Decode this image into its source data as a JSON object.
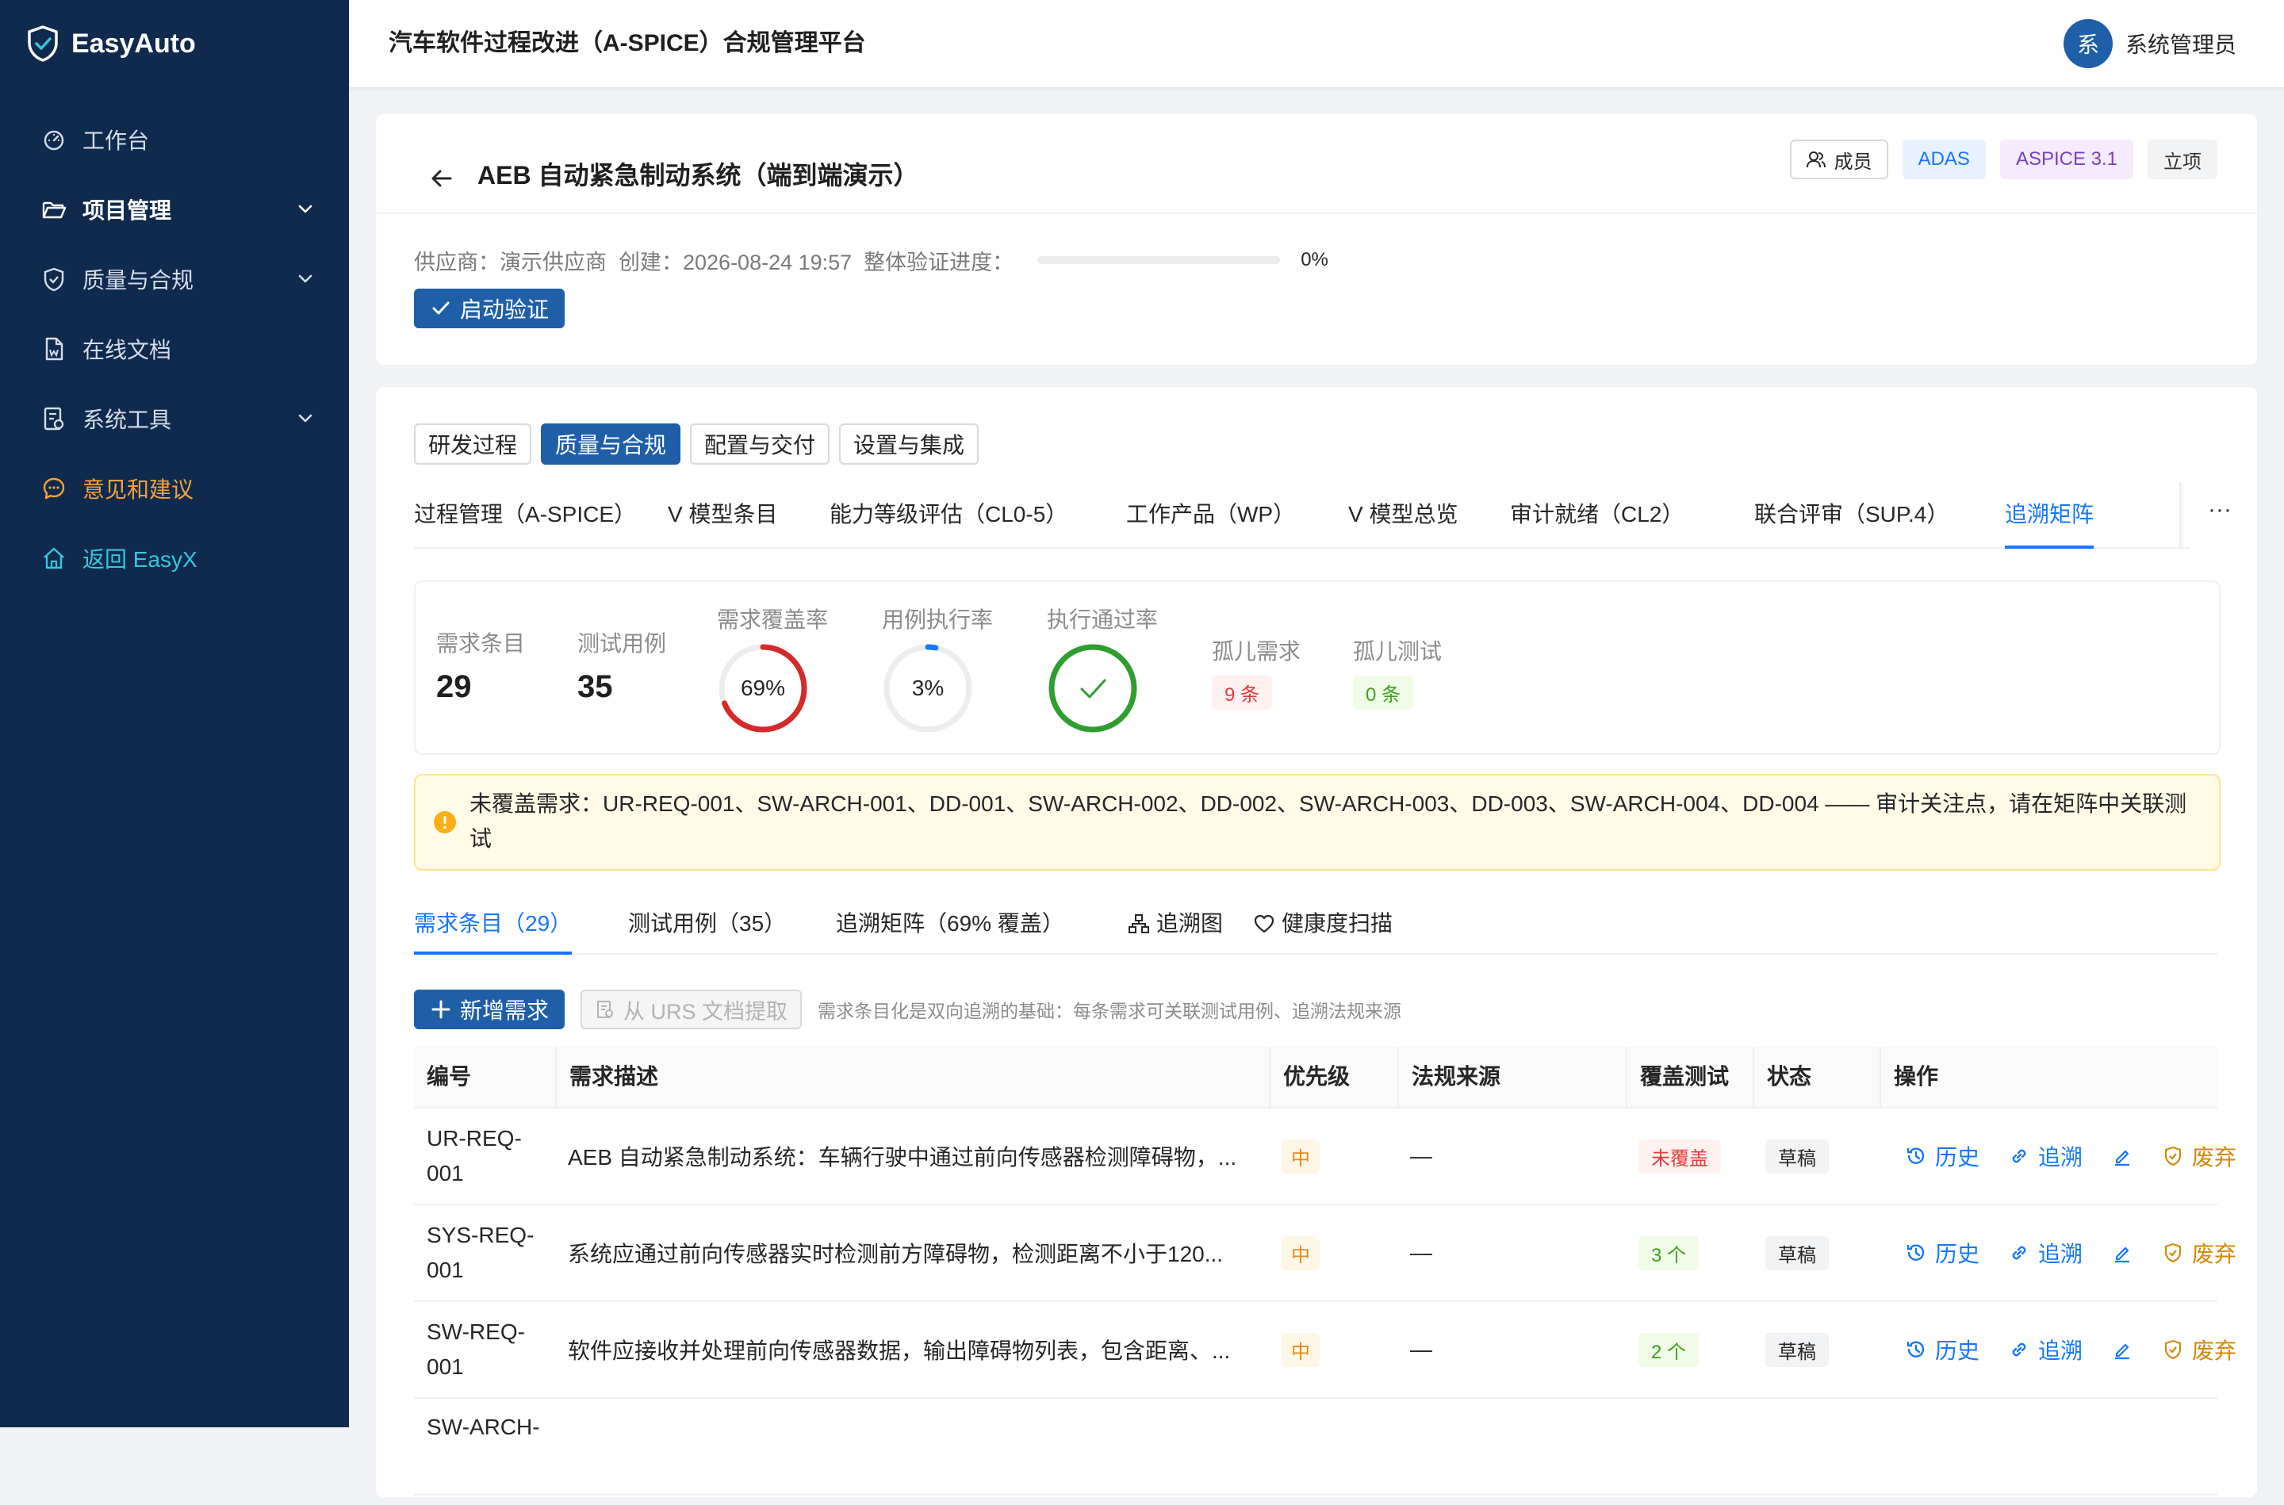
{
  "sidebar": {
    "brand": "EasyAuto",
    "items": [
      {
        "label": "工作台"
      },
      {
        "label": "项目管理"
      },
      {
        "label": "质量与合规"
      },
      {
        "label": "在线文档"
      },
      {
        "label": "系统工具"
      },
      {
        "label": "意见和建议"
      },
      {
        "label": "返回 EasyX"
      }
    ]
  },
  "header": {
    "title": "汽车软件过程改进（A-SPICE）合规管理平台",
    "avatar_text": "系",
    "user_name": "系统管理员"
  },
  "project": {
    "title": "AEB 自动紧急制动系统（端到端演示）",
    "tags": {
      "member": "成员",
      "domain": "ADAS",
      "standard": "ASPICE 3.1",
      "stage": "立项"
    },
    "meta": "供应商：演示供应商  创建：2026-08-24 19:57  整体验证进度：",
    "progress": 0,
    "progress_label": "0%",
    "start_button": "启动验证"
  },
  "group_tabs": [
    "研发过程",
    "质量与合规",
    "配置与交付",
    "设置与集成"
  ],
  "sub_tabs": [
    "过程管理（A-SPICE）",
    "V 模型条目",
    "能力等级评估（CL0-5）",
    "工作产品（WP）",
    "V 模型总览",
    "审计就绪（CL2）",
    "联合评审（SUP.4）",
    "追溯矩阵"
  ],
  "more": "···",
  "stats": {
    "req_label": "需求条目",
    "req_value": "29",
    "test_label": "测试用例",
    "test_value": "35",
    "coverage_label": "需求覆盖率",
    "coverage_text": "69%",
    "coverage_pct": 69,
    "exec_label": "用例执行率",
    "exec_text": "3%",
    "exec_pct": 3,
    "pass_label": "执行通过率",
    "pass_pct": 100,
    "orphan_req_label": "孤儿需求",
    "orphan_req_value": "9 条",
    "orphan_test_label": "孤儿测试",
    "orphan_test_value": "0 条"
  },
  "alert": "未覆盖需求：UR-REQ-001、SW-ARCH-001、DD-001、SW-ARCH-002、DD-002、SW-ARCH-003、DD-003、SW-ARCH-004、DD-004 —— 审计关注点，请在矩阵中关联测试",
  "inner_tabs": [
    "需求条目（29）",
    "测试用例（35）",
    "追溯矩阵（69% 覆盖）",
    "追溯图",
    "健康度扫描"
  ],
  "toolbar": {
    "add": "新增需求",
    "extract": "从 URS 文档提取",
    "hint": "需求条目化是双向追溯的基础：每条需求可关联测试用例、追溯法规来源"
  },
  "table": {
    "headers": [
      "编号",
      "需求描述",
      "优先级",
      "法规来源",
      "覆盖测试",
      "状态",
      "操作"
    ],
    "actions": {
      "history": "历史",
      "trace": "追溯",
      "discard": "废弃"
    },
    "rows": [
      {
        "code": "UR-REQ-001",
        "desc": "AEB 自动紧急制动系统：车辆行驶中通过前向传感器检测障碍物，...",
        "priority": "中",
        "source": "—",
        "coverage": "未覆盖",
        "status": "草稿"
      },
      {
        "code": "SYS-REQ-001",
        "desc": "系统应通过前向传感器实时检测前方障碍物，检测距离不小于120...",
        "priority": "中",
        "source": "—",
        "coverage": "3 个",
        "status": "草稿"
      },
      {
        "code": "SW-REQ-001",
        "desc": "软件应接收并处理前向传感器数据，输出障碍物列表，包含距离、...",
        "priority": "中",
        "source": "—",
        "coverage": "2 个",
        "status": "草稿"
      },
      {
        "code": "SW-ARCH-",
        "desc": "",
        "priority": "",
        "source": "",
        "coverage": "",
        "status": ""
      }
    ]
  },
  "colors": {
    "sidebar": "#0f2a4d",
    "primary": "#1f5fa8",
    "link": "#1677ff",
    "danger": "#d42a2a",
    "success": "#2f9e2f"
  }
}
